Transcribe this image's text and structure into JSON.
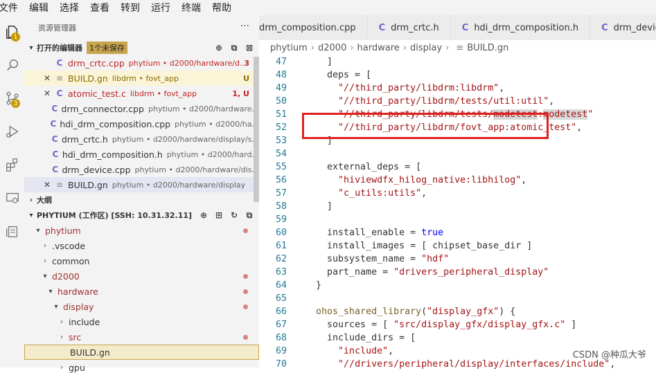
{
  "menu": [
    "文件",
    "编辑",
    "选择",
    "查看",
    "转到",
    "运行",
    "终端",
    "帮助"
  ],
  "activity": {
    "explorer_badge": "1",
    "scm_badge": "3"
  },
  "sidebar": {
    "title": "资源管理器",
    "open_editors_label": "打开的编辑器",
    "unsaved_label": "1个未保存",
    "open_editors": [
      {
        "name": "drm_crtc.cpp",
        "desc": "phytium • d2000/hardware/d...",
        "status": "3",
        "icon": "C"
      },
      {
        "name": "BUILD.gn",
        "desc": "libdrm • fovt_app",
        "status": "U",
        "icon": "≡"
      },
      {
        "name": "atomic_test.c",
        "desc": "libdrm • fovt_app",
        "status": "1, U",
        "icon": "C"
      },
      {
        "name": "drm_connector.cpp",
        "desc": "phytium • d2000/hardware...",
        "status": "",
        "icon": "C"
      },
      {
        "name": "hdi_drm_composition.cpp",
        "desc": "phytium • d2000/ha...",
        "status": "",
        "icon": "C"
      },
      {
        "name": "drm_crtc.h",
        "desc": "phytium • d2000/hardware/display/s...",
        "status": "",
        "icon": "C"
      },
      {
        "name": "hdi_drm_composition.h",
        "desc": "phytium • d2000/hard...",
        "status": "",
        "icon": "C"
      },
      {
        "name": "drm_device.cpp",
        "desc": "phytium • d2000/hardware/dis...",
        "status": "",
        "icon": "C"
      },
      {
        "name": "BUILD.gn",
        "desc": "phytium • d2000/hardware/display",
        "status": "",
        "icon": "≡"
      }
    ],
    "outline_label": "大纲",
    "workspace_label": "PHYTIUM (工作区) [SSH: 10.31.32.11]",
    "tree": [
      {
        "name": "phytium",
        "depth": 0
      },
      {
        "name": ".vscode",
        "depth": 1
      },
      {
        "name": "common",
        "depth": 1
      },
      {
        "name": "d2000",
        "depth": 1
      },
      {
        "name": "hardware",
        "depth": 2
      },
      {
        "name": "display",
        "depth": 3
      },
      {
        "name": "include",
        "depth": 4
      },
      {
        "name": "src",
        "depth": 4
      },
      {
        "name": "BUILD.gn",
        "depth": 4
      },
      {
        "name": "gpu",
        "depth": 3
      }
    ]
  },
  "tabs": [
    {
      "name": "drm_composition.cpp",
      "icon": ""
    },
    {
      "name": "drm_crtc.h",
      "icon": "C"
    },
    {
      "name": "hdi_drm_composition.h",
      "icon": "C"
    },
    {
      "name": "drm_device",
      "icon": "C"
    }
  ],
  "breadcrumb": [
    "phytium",
    "d2000",
    "hardware",
    "display",
    "BUILD.gn"
  ],
  "code": [
    {
      "n": "47",
      "t": "    ]"
    },
    {
      "n": "48",
      "t": "    deps = ["
    },
    {
      "n": "49",
      "t": "      \"//third_party/libdrm:libdrm\","
    },
    {
      "n": "50",
      "t": "      \"//third_party/libdrm/tests/util:util\","
    },
    {
      "n": "51",
      "t": "      \"//third_party/libdrm/tests/modetest:modetest\""
    },
    {
      "n": "52",
      "t": "      \"//third_party/libdrm/fovt_app:atomic_test\","
    },
    {
      "n": "53",
      "t": "    ]"
    },
    {
      "n": "54",
      "t": ""
    },
    {
      "n": "55",
      "t": "    external_deps = ["
    },
    {
      "n": "56",
      "t": "      \"hiviewdfx_hilog_native:libhilog\","
    },
    {
      "n": "57",
      "t": "      \"c_utils:utils\","
    },
    {
      "n": "58",
      "t": "    ]"
    },
    {
      "n": "59",
      "t": ""
    },
    {
      "n": "60",
      "t": "    install_enable = true"
    },
    {
      "n": "61",
      "t": "    install_images = [ chipset_base_dir ]"
    },
    {
      "n": "62",
      "t": "    subsystem_name = \"hdf\""
    },
    {
      "n": "63",
      "t": "    part_name = \"drivers_peripheral_display\""
    },
    {
      "n": "64",
      "t": "  }"
    },
    {
      "n": "65",
      "t": ""
    },
    {
      "n": "66",
      "t": "  ohos_shared_library(\"display_gfx\") {"
    },
    {
      "n": "67",
      "t": "    sources = [ \"src/display_gfx/display_gfx.c\" ]"
    },
    {
      "n": "68",
      "t": "    include_dirs = ["
    },
    {
      "n": "69",
      "t": "      \"include\","
    },
    {
      "n": "70",
      "t": "      \"//drivers/peripheral/display/interfaces/include\","
    }
  ],
  "watermark": "CSDN @种瓜大爷"
}
